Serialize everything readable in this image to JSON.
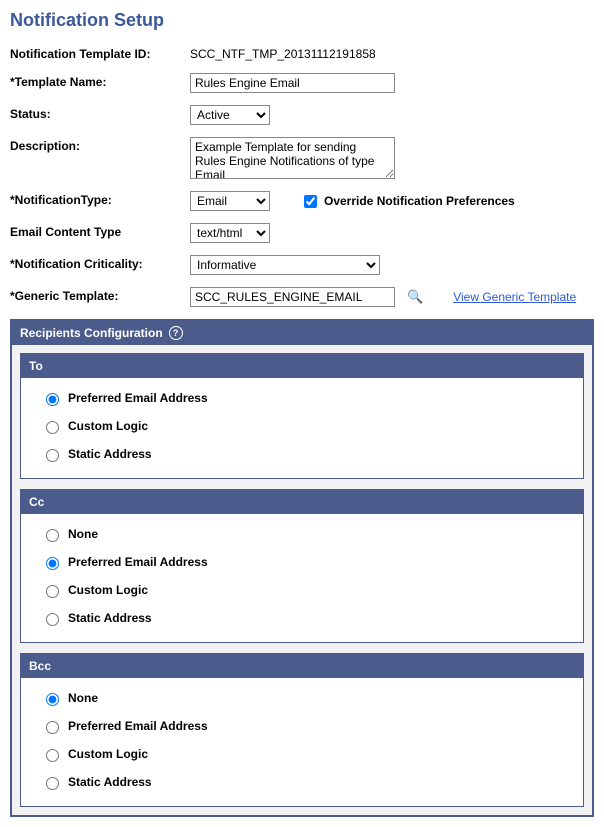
{
  "page_title": "Notification Setup",
  "labels": {
    "template_id": "Notification Template ID:",
    "template_name": "*Template Name:",
    "status": "Status:",
    "description": "Description:",
    "notification_type": "*NotificationType:",
    "override_preferences": "Override Notification Preferences",
    "email_content_type": "Email Content Type",
    "notification_criticality": "*Notification Criticality:",
    "generic_template": "*Generic Template:",
    "view_generic_template": "View Generic Template"
  },
  "values": {
    "template_id": "SCC_NTF_TMP_20131112191858",
    "template_name": "Rules Engine Email",
    "status": "Active",
    "description": "Example Template for sending Rules Engine Notifications of type Email",
    "notification_type": "Email",
    "override_preferences": true,
    "email_content_type": "text/html",
    "notification_criticality": "Informative",
    "generic_template": "SCC_RULES_ENGINE_EMAIL"
  },
  "recipients": {
    "title": "Recipients Configuration",
    "sections": {
      "to": {
        "title": "To",
        "options": {
          "preferred": "Preferred Email Address",
          "custom": "Custom Logic",
          "static": "Static Address"
        },
        "selected": "preferred"
      },
      "cc": {
        "title": "Cc",
        "options": {
          "none": "None",
          "preferred": "Preferred Email Address",
          "custom": "Custom Logic",
          "static": "Static Address"
        },
        "selected": "preferred"
      },
      "bcc": {
        "title": "Bcc",
        "options": {
          "none": "None",
          "preferred": "Preferred Email Address",
          "custom": "Custom Logic",
          "static": "Static Address"
        },
        "selected": "none"
      }
    }
  }
}
